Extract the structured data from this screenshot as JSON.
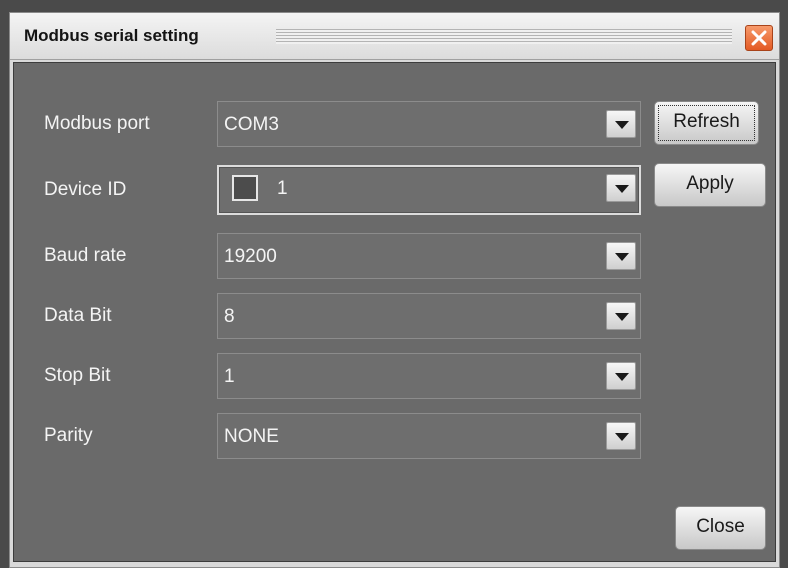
{
  "window": {
    "title": "Modbus serial setting"
  },
  "fields": [
    {
      "label": "Modbus port",
      "value": "COM3"
    },
    {
      "label": "Device ID",
      "value": "1"
    },
    {
      "label": "Baud rate",
      "value": "19200"
    },
    {
      "label": "Data Bit",
      "value": "8"
    },
    {
      "label": "Stop Bit",
      "value": "1"
    },
    {
      "label": "Parity",
      "value": "NONE"
    }
  ],
  "buttons": {
    "refresh": "Refresh",
    "apply": "Apply",
    "close": "Close"
  },
  "colors": {
    "panel": "#6a6a6a",
    "close_accent": "#e35a24"
  },
  "icons": {
    "close": "close-x-icon",
    "dropdown": "chevron-down-icon"
  }
}
